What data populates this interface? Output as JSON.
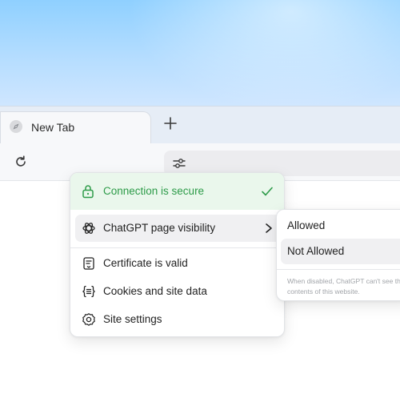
{
  "browser": {
    "tab": {
      "title": "New Tab"
    },
    "new_tab_label": "+"
  },
  "popover": {
    "secure": {
      "label": "Connection is secure"
    },
    "items": [
      {
        "label": "ChatGPT page visibility",
        "icon": "chatgpt-icon"
      },
      {
        "label": "Certificate is valid",
        "icon": "certificate-icon"
      },
      {
        "label": "Cookies and site data",
        "icon": "cookies-icon"
      },
      {
        "label": "Site settings",
        "icon": "gear-icon"
      }
    ]
  },
  "submenu": {
    "options": [
      {
        "label": "Allowed"
      },
      {
        "label": "Not Allowed",
        "selected": true
      }
    ],
    "note_line1": "When disabled, ChatGPT can't see th",
    "note_line2": "contents of this website."
  },
  "colors": {
    "secure_green": "#2c9b48",
    "secure_bg": "#eaf7ec",
    "sky_top": "#8fd0ff"
  }
}
